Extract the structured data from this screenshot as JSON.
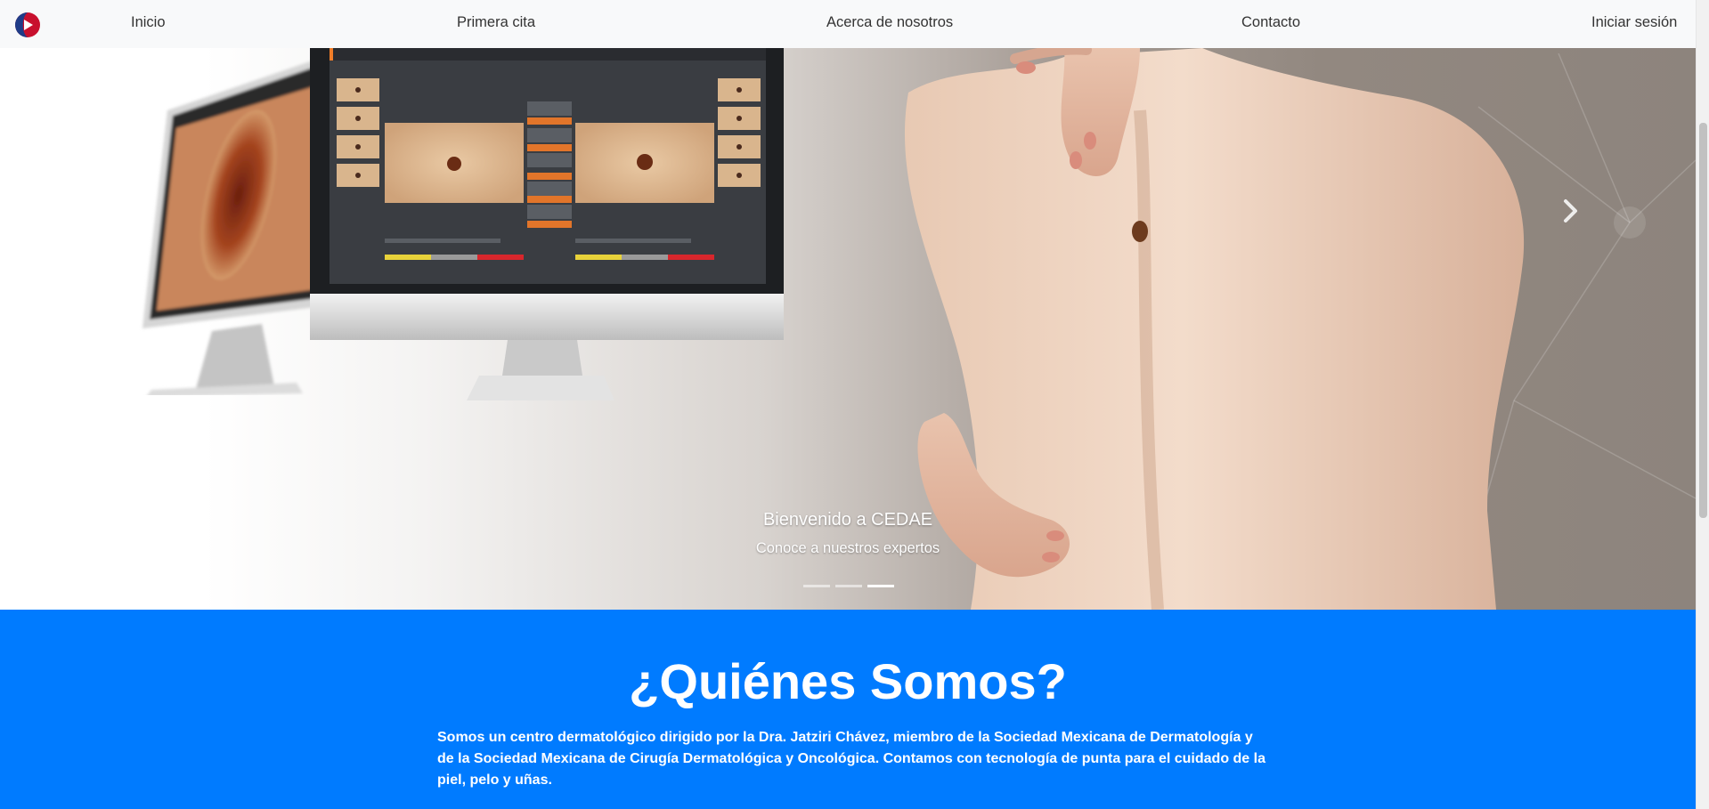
{
  "nav": {
    "logo_icon": "cedae-logo-icon",
    "items": [
      {
        "label": "Inicio"
      },
      {
        "label": "Primera cita"
      },
      {
        "label": "Acerca de nosotros"
      },
      {
        "label": "Contacto"
      },
      {
        "label": "Iniciar sesión"
      }
    ]
  },
  "hero": {
    "caption_title": "Bienvenido a CEDAE",
    "caption_subtitle": "Conoce a nuestros expertos",
    "next_icon": "chevron-right-icon",
    "slide_count": 3,
    "active_slide": 3
  },
  "about": {
    "title": "¿Quiénes Somos?",
    "text": "Somos un centro dermatológico dirigido por la Dra. Jatziri Chávez, miembro de la Sociedad Mexicana de Dermatología y de la Sociedad Mexicana de Cirugía Dermatológica y Oncológica. Contamos con tecnología de punta para el cuidado de la piel, pelo y uñas."
  },
  "colors": {
    "navbar_bg": "#f8f9fa",
    "about_bg": "#007bff",
    "logo_red": "#c8102e",
    "logo_blue": "#1f3c88"
  }
}
